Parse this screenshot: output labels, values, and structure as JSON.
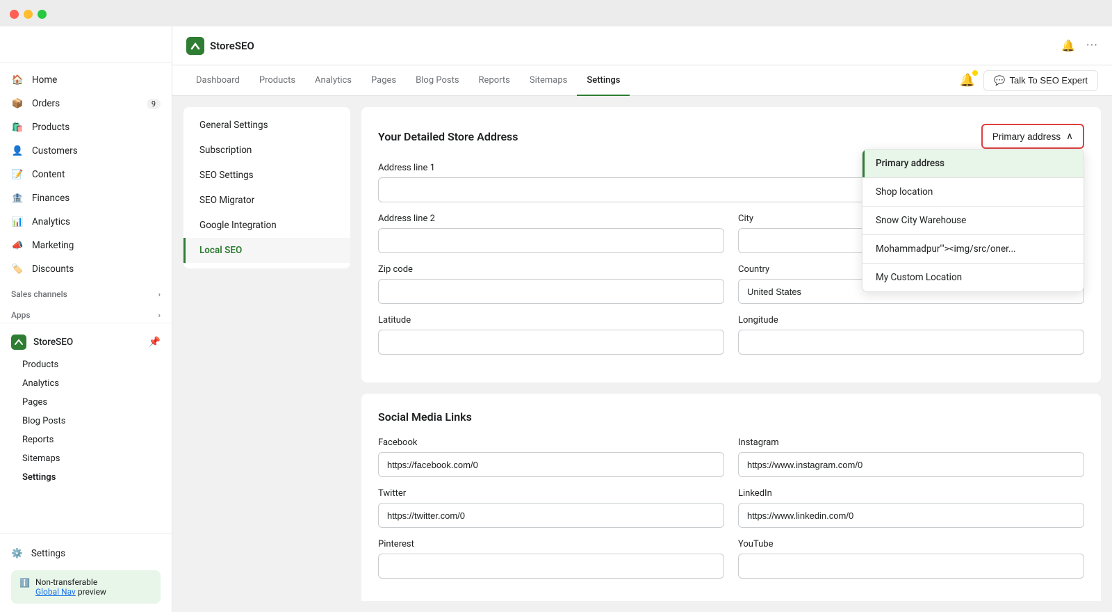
{
  "window": {
    "title": "StoreSEO"
  },
  "window_controls": {
    "red": "close",
    "yellow": "minimize",
    "green": "maximize"
  },
  "sidebar": {
    "items": [
      {
        "id": "home",
        "label": "Home",
        "icon": "🏠",
        "badge": null
      },
      {
        "id": "orders",
        "label": "Orders",
        "icon": "📦",
        "badge": "9"
      },
      {
        "id": "products",
        "label": "Products",
        "icon": "🛍️",
        "badge": null
      },
      {
        "id": "customers",
        "label": "Customers",
        "icon": "👤",
        "badge": null
      },
      {
        "id": "content",
        "label": "Content",
        "icon": "📝",
        "badge": null
      },
      {
        "id": "finances",
        "label": "Finances",
        "icon": "🏦",
        "badge": null
      },
      {
        "id": "analytics",
        "label": "Analytics",
        "icon": "📊",
        "badge": null
      },
      {
        "id": "marketing",
        "label": "Marketing",
        "icon": "📣",
        "badge": null
      },
      {
        "id": "discounts",
        "label": "Discounts",
        "icon": "🏷️",
        "badge": null
      }
    ],
    "sales_channels_label": "Sales channels",
    "apps_label": "Apps",
    "storeseo": {
      "label": "StoreSEO",
      "sub_items": [
        {
          "id": "products",
          "label": "Products"
        },
        {
          "id": "analytics",
          "label": "Analytics"
        },
        {
          "id": "pages",
          "label": "Pages"
        },
        {
          "id": "blog-posts",
          "label": "Blog Posts"
        },
        {
          "id": "reports",
          "label": "Reports"
        },
        {
          "id": "sitemaps",
          "label": "Sitemaps"
        },
        {
          "id": "settings",
          "label": "Settings",
          "active": true
        }
      ]
    },
    "settings_label": "Settings",
    "footer": {
      "non_transferable_text": "Non-transferable",
      "global_nav_text": "Global Nav",
      "preview_text": "preview"
    }
  },
  "topbar": {
    "app_name": "StoreSEO",
    "bell_icon": "🔔",
    "more_icon": "···"
  },
  "nav_tabs": {
    "items": [
      {
        "id": "dashboard",
        "label": "Dashboard",
        "active": false
      },
      {
        "id": "products",
        "label": "Products",
        "active": false
      },
      {
        "id": "analytics",
        "label": "Analytics",
        "active": false
      },
      {
        "id": "pages",
        "label": "Pages",
        "active": false
      },
      {
        "id": "blog-posts",
        "label": "Blog Posts",
        "active": false
      },
      {
        "id": "reports",
        "label": "Reports",
        "active": false
      },
      {
        "id": "sitemaps",
        "label": "Sitemaps",
        "active": false
      },
      {
        "id": "settings",
        "label": "Settings",
        "active": true
      }
    ],
    "talk_btn": "Talk To SEO Expert"
  },
  "settings_menu": {
    "items": [
      {
        "id": "general",
        "label": "General Settings",
        "active": false
      },
      {
        "id": "subscription",
        "label": "Subscription",
        "active": false
      },
      {
        "id": "seo-settings",
        "label": "SEO Settings",
        "active": false
      },
      {
        "id": "seo-migrator",
        "label": "SEO Migrator",
        "active": false
      },
      {
        "id": "google",
        "label": "Google Integration",
        "active": false
      },
      {
        "id": "local-seo",
        "label": "Local SEO",
        "active": true
      }
    ]
  },
  "store_address_card": {
    "title": "Your Detailed Store Address",
    "primary_addr_btn": "Primary address",
    "dropdown_items": [
      {
        "id": "primary",
        "label": "Primary address",
        "active": true
      },
      {
        "id": "shop",
        "label": "Shop location",
        "active": false
      },
      {
        "id": "snow-city",
        "label": "Snow City Warehouse",
        "active": false
      },
      {
        "id": "mohammadpur",
        "label": "Mohammadpur'\"><img/src/oner...",
        "active": false
      },
      {
        "id": "custom",
        "label": "My Custom Location",
        "active": false
      }
    ],
    "fields": {
      "address_line1_label": "Address line 1",
      "address_line1_value": "",
      "address_line2_label": "Address line 2",
      "address_line2_value": "",
      "city_label": "City",
      "city_value": "",
      "zip_label": "Zip code",
      "zip_value": "",
      "country_label": "Country",
      "country_value": "United States",
      "latitude_label": "Latitude",
      "latitude_value": "",
      "longitude_label": "Longitude",
      "longitude_value": ""
    }
  },
  "social_media_card": {
    "title": "Social Media Links",
    "fields": {
      "facebook_label": "Facebook",
      "facebook_value": "https://facebook.com/0",
      "instagram_label": "Instagram",
      "instagram_value": "https://www.instagram.com/0",
      "twitter_label": "Twitter",
      "twitter_value": "https://twitter.com/0",
      "linkedin_label": "LinkedIn",
      "linkedin_value": "https://www.linkedin.com/0",
      "pinterest_label": "Pinterest",
      "pinterest_value": "",
      "youtube_label": "YouTube",
      "youtube_value": ""
    }
  }
}
